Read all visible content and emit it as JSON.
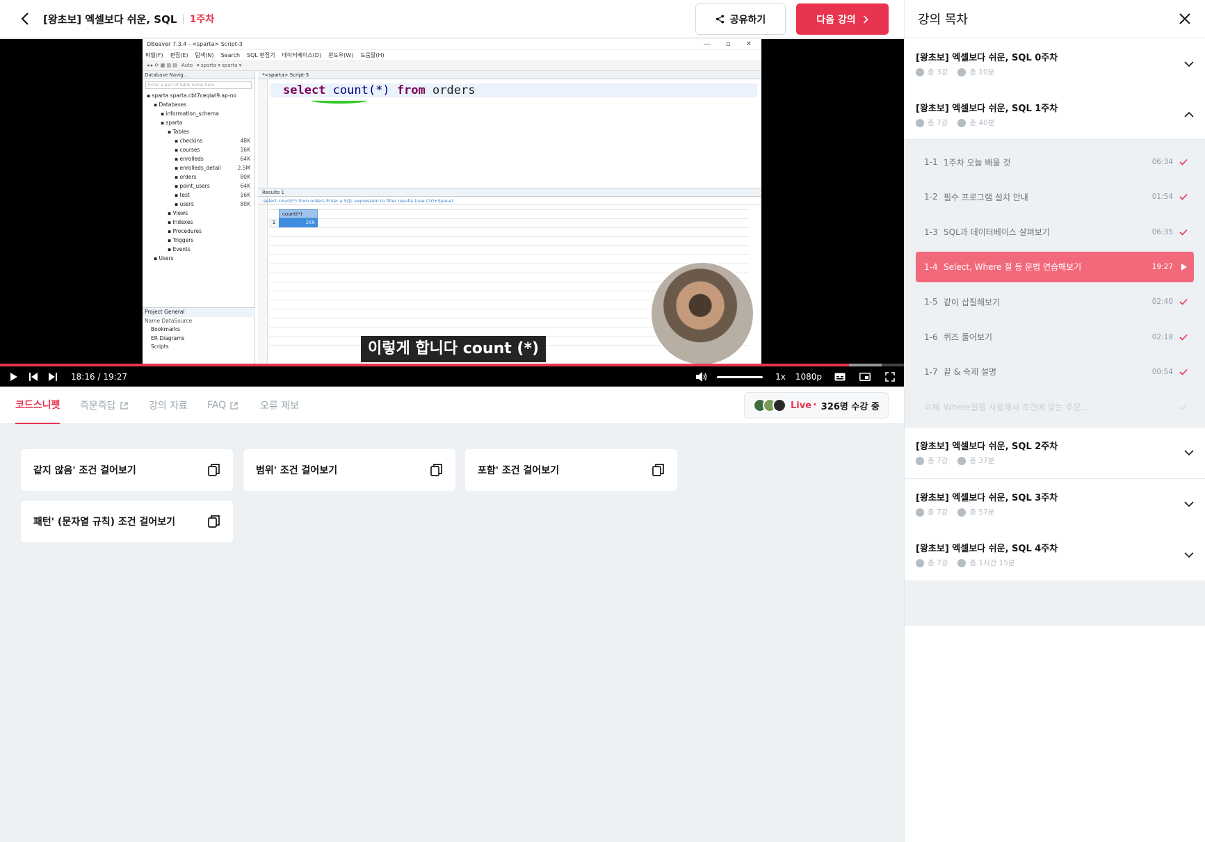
{
  "header": {
    "course_title": "[왕초보] 엑셀보다 쉬운, SQL",
    "week_label": "1주차",
    "share_label": "공유하기",
    "next_label": "다음 강의"
  },
  "video": {
    "current_time": "18:16 /",
    "duration": "19:27",
    "progress": 0.939,
    "buffered": 0.975,
    "speed": "1x",
    "quality": "1080p",
    "subtitle": "이렇게 합니다 count (*)"
  },
  "screen": {
    "window_title": "DBeaver 7.3.4 - <sparta> Script-3",
    "menu": [
      "파일(F)",
      "편집(E)",
      "탐색(N)",
      "Search",
      "SQL 편집기",
      "데이터베이스(D)",
      "윈도우(W)",
      "도움말(H)"
    ],
    "nav_tab": "Database Navig...",
    "filter_placeholder": "Enter a part of table name here",
    "tree": [
      {
        "label": "sparta  sparta.cbt7ceqiwl9.ap-no",
        "indent": 0,
        "size": ""
      },
      {
        "label": "Databases",
        "indent": 1,
        "size": ""
      },
      {
        "label": "information_schema",
        "indent": 2,
        "size": ""
      },
      {
        "label": "sparta",
        "indent": 2,
        "size": ""
      },
      {
        "label": "Tables",
        "indent": 3,
        "size": ""
      },
      {
        "label": "checkins",
        "indent": 4,
        "size": "48K"
      },
      {
        "label": "courses",
        "indent": 4,
        "size": "16K"
      },
      {
        "label": "enrolleds",
        "indent": 4,
        "size": "64K"
      },
      {
        "label": "enrolleds_detail",
        "indent": 4,
        "size": "2.5M"
      },
      {
        "label": "orders",
        "indent": 4,
        "size": "80K"
      },
      {
        "label": "point_users",
        "indent": 4,
        "size": "64K"
      },
      {
        "label": "test",
        "indent": 4,
        "size": "16K"
      },
      {
        "label": "users",
        "indent": 4,
        "size": "80K"
      },
      {
        "label": "Views",
        "indent": 3,
        "size": ""
      },
      {
        "label": "Indexes",
        "indent": 3,
        "size": ""
      },
      {
        "label": "Procedures",
        "indent": 3,
        "size": ""
      },
      {
        "label": "Triggers",
        "indent": 3,
        "size": ""
      },
      {
        "label": "Events",
        "indent": 3,
        "size": ""
      },
      {
        "label": "Users",
        "indent": 1,
        "size": ""
      }
    ],
    "project_tabs": "Project   General",
    "project_cols": "Name                     DataSource",
    "project_items": [
      "Bookmarks",
      "ER Diagrams",
      "Scripts"
    ],
    "editor_tab": "*<sparta> Script-3",
    "code_select": "select",
    "code_count": "count(*)",
    "code_from": "from",
    "code_table": "orders",
    "results_tab": "Results 1",
    "results_filter": "select count(*) from orders   Enter a SQL expression to filter results (use Ctrl+Space)",
    "col_header": "count(*)",
    "row_num": "1",
    "cell_value": "266"
  },
  "tabs": [
    {
      "label": "코드스니펫",
      "external": false
    },
    {
      "label": "즉문즉답",
      "external": true
    },
    {
      "label": "강의 자료",
      "external": false
    },
    {
      "label": "FAQ",
      "external": true
    },
    {
      "label": "오류 제보",
      "external": false
    }
  ],
  "live": {
    "label": "Live",
    "count": "326명 수강 중"
  },
  "snippets": [
    "같지 않음' 조건 걸어보기",
    "범위' 조건 걸어보기",
    "포함' 조건 걸어보기",
    "패턴' (문자열 규칙) 조건 걸어보기"
  ],
  "sidebar": {
    "title": "강의 목차",
    "weeks": [
      {
        "title": "[왕초보] 엑셀보다 쉬운, SQL 0주차",
        "count": "총 3강",
        "time": "총 10분",
        "expanded": false
      },
      {
        "title": "[왕초보] 엑셀보다 쉬운, SQL 1주차",
        "count": "총 7강",
        "time": "총 40분",
        "expanded": true
      },
      {
        "title": "[왕초보] 엑셀보다 쉬운, SQL 2주차",
        "count": "총 7강",
        "time": "총 37분",
        "expanded": false
      },
      {
        "title": "[왕초보] 엑셀보다 쉬운, SQL 3주차",
        "count": "총 7강",
        "time": "총 57분",
        "expanded": false
      },
      {
        "title": "[왕초보] 엑셀보다 쉬운, SQL 4주차",
        "count": "총 7강",
        "time": "총 1시간 15분",
        "expanded": false
      }
    ],
    "lessons": [
      {
        "num": "1-1",
        "title": "1주차 오늘 배울 것",
        "duration": "06:34",
        "state": "done"
      },
      {
        "num": "1-2",
        "title": "필수 프로그램 설치 안내",
        "duration": "01:54",
        "state": "done"
      },
      {
        "num": "1-3",
        "title": "SQL과 데이터베이스 살펴보기",
        "duration": "06:35",
        "state": "done"
      },
      {
        "num": "1-4",
        "title": "Select, Where 절 등 문법 연습해보기",
        "duration": "19:27",
        "state": "playing"
      },
      {
        "num": "1-5",
        "title": "같이 삽질해보기",
        "duration": "02:40",
        "state": "done"
      },
      {
        "num": "1-6",
        "title": "퀴즈 풀어보기",
        "duration": "02:18",
        "state": "done"
      },
      {
        "num": "1-7",
        "title": "끝 & 숙제 설명",
        "duration": "00:54",
        "state": "done"
      },
      {
        "num": "숙제",
        "title": "Where절을 사용해서 조건에 맞는 주문...",
        "duration": "",
        "state": "locked"
      }
    ]
  },
  "colors": {
    "accent": "#e8344e",
    "active_lesson": "#f2697b",
    "bg": "#eef1f4"
  }
}
